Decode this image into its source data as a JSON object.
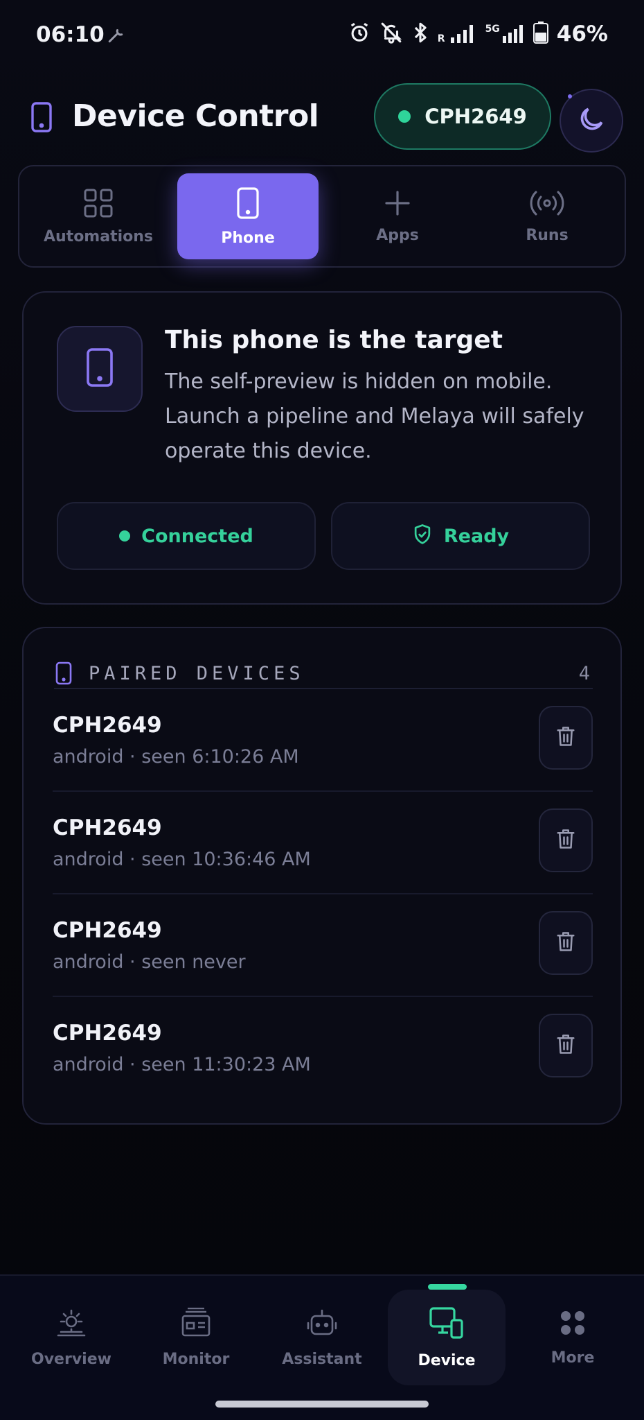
{
  "status_bar": {
    "time": "06:10",
    "battery": "46%",
    "network_r": "R",
    "network_5g": "5G",
    "icons": [
      "wrench-icon",
      "alarm-icon",
      "bell-off-icon",
      "bluetooth-icon",
      "signal-icon",
      "battery-icon"
    ]
  },
  "header": {
    "title": "Device Control",
    "device_name": "CPH2649",
    "status_color": "#2fd49a"
  },
  "tabs": [
    {
      "label": "Automations",
      "icon": "grid-icon",
      "active": false
    },
    {
      "label": "Phone",
      "icon": "phone-icon",
      "active": true
    },
    {
      "label": "Apps",
      "icon": "plus-icon",
      "active": false
    },
    {
      "label": "Runs",
      "icon": "broadcast-icon",
      "active": false
    }
  ],
  "target_card": {
    "heading": "This phone is the target",
    "body": "The self-preview is hidden on mobile. Launch a pipeline and Melaya will safely operate this device.",
    "connected_label": "Connected",
    "ready_label": "Ready"
  },
  "paired": {
    "heading": "PAIRED DEVICES",
    "count": "4",
    "devices": [
      {
        "name": "CPH2649",
        "meta": "android · seen 6:10:26 AM"
      },
      {
        "name": "CPH2649",
        "meta": "android · seen 10:36:46 AM"
      },
      {
        "name": "CPH2649",
        "meta": "android · seen never"
      },
      {
        "name": "CPH2649",
        "meta": "android · seen 11:30:23 AM"
      }
    ]
  },
  "bottom_nav": [
    {
      "label": "Overview",
      "icon": "sun-icon",
      "active": false
    },
    {
      "label": "Monitor",
      "icon": "monitor-icon",
      "active": false
    },
    {
      "label": "Assistant",
      "icon": "robot-icon",
      "active": false
    },
    {
      "label": "Device",
      "icon": "devices-icon",
      "active": true
    },
    {
      "label": "More",
      "icon": "dots-grid-icon",
      "active": false
    }
  ],
  "colors": {
    "accent": "#7a68ee",
    "success": "#35d19b",
    "background": "#07080f"
  }
}
